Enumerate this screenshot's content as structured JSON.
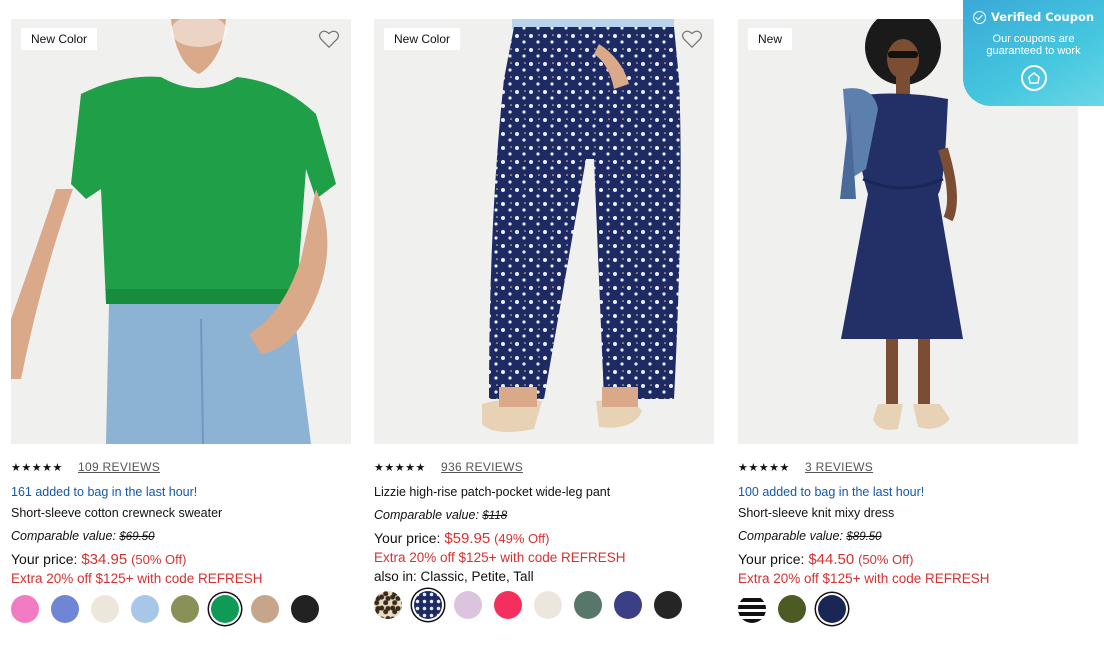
{
  "products": [
    {
      "badge": "New Color",
      "stars": "★★★★★",
      "reviews": "109 REVIEWS",
      "added": "161 added to bag in the last hour!",
      "name": "Short-sleeve cotton crewneck sweater",
      "comparable_label": "Comparable value:",
      "comparable_value": "$69.50",
      "price_label": "Your price:",
      "price": "$34.95",
      "discount": "(50% Off)",
      "promo": "Extra 20% off $125+ with code REFRESH",
      "swatches": [
        "#f27cc3",
        "#6f86d6",
        "#ede6dd",
        "#a7c6e8",
        "#8a9158",
        "#0f9a57",
        "#c6a58a",
        "#222222"
      ],
      "selected_swatch": 5
    },
    {
      "badge": "New Color",
      "stars": "★★★★★",
      "reviews": "936 REVIEWS",
      "name": "Lizzie high-rise patch-pocket wide-leg pant",
      "comparable_label": "Comparable value:",
      "comparable_value": "$118",
      "price_label": "Your price:",
      "price": "$59.95",
      "discount": "(49% Off)",
      "promo": "Extra 20% off $125+ with code REFRESH",
      "also": "also in: Classic, Petite, Tall",
      "swatches": [
        "leopard",
        "floral-navy",
        "#dcc4df",
        "#f52f5d",
        "#ede6dd",
        "#57776a",
        "#3b3f86",
        "#252525"
      ],
      "selected_swatch": 1
    },
    {
      "badge": "New",
      "stars": "★★★★★",
      "reviews": "3 REVIEWS",
      "added": "100 added to bag in the last hour!",
      "name": "Short-sleeve knit mixy dress",
      "comparable_label": "Comparable value:",
      "comparable_value": "$89.50",
      "price_label": "Your price:",
      "price": "$44.50",
      "discount": "(50% Off)",
      "promo": "Extra 20% off $125+ with code REFRESH",
      "swatches": [
        "stripe",
        "#4c5a23",
        "#1a2756"
      ],
      "selected_swatch": 2
    }
  ],
  "coupon": {
    "title": "Verified Coupon",
    "subtitle": "Our coupons are guaranteed to work"
  },
  "colors": {
    "price_red": "#d63131",
    "link_blue": "#1458a8",
    "coupon_gradient": "#3aa8d8"
  }
}
